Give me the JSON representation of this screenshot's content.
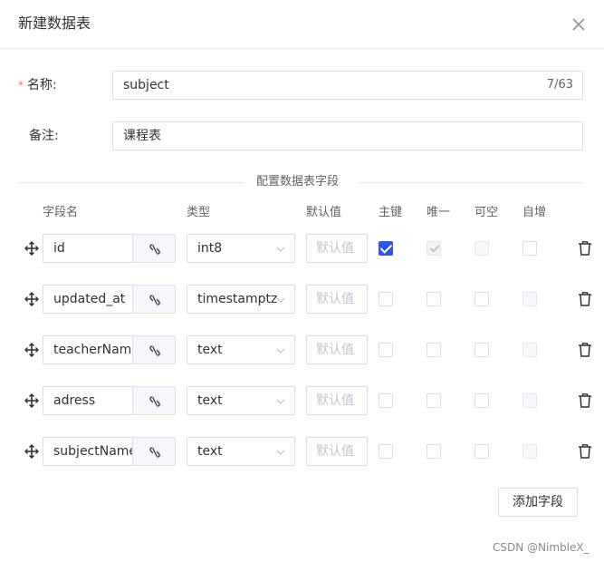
{
  "dialog": {
    "title": "新建数据表",
    "close_icon": "close-icon"
  },
  "form": {
    "name_required_mark": "*",
    "name_label": "名称:",
    "name_value": "subject",
    "name_counter": "7/63",
    "remark_label": "备注:",
    "remark_value": "课程表"
  },
  "fields_section": {
    "title": "配置数据表字段",
    "columns": {
      "name": "字段名",
      "type": "类型",
      "default": "默认值",
      "primary": "主键",
      "unique": "唯一",
      "nullable": "可空",
      "auto_inc": "自增"
    },
    "default_placeholder": "默认值",
    "rows": [
      {
        "name": "id",
        "type": "int8",
        "primary": true,
        "unique": true,
        "unique_disabled": true,
        "nullable_disabled": true,
        "auto_inc_disabled": false
      },
      {
        "name": "updated_at",
        "type": "timestamptz",
        "primary": false,
        "unique": false,
        "unique_disabled": false,
        "nullable_disabled": false,
        "auto_inc_disabled": true
      },
      {
        "name": "teacherNam",
        "type": "text",
        "primary": false,
        "unique": false,
        "unique_disabled": false,
        "nullable_disabled": false,
        "auto_inc_disabled": true
      },
      {
        "name": "adress",
        "type": "text",
        "primary": false,
        "unique": false,
        "unique_disabled": false,
        "nullable_disabled": false,
        "auto_inc_disabled": true
      },
      {
        "name": "subjectName",
        "type": "text",
        "primary": false,
        "unique": false,
        "unique_disabled": false,
        "nullable_disabled": false,
        "auto_inc_disabled": true
      }
    ],
    "add_button_label": "添加字段"
  },
  "watermark": "CSDN @NimbleX_",
  "colors": {
    "accent": "#2f54eb",
    "required": "#f56c6c",
    "border": "#dcdfe6"
  }
}
